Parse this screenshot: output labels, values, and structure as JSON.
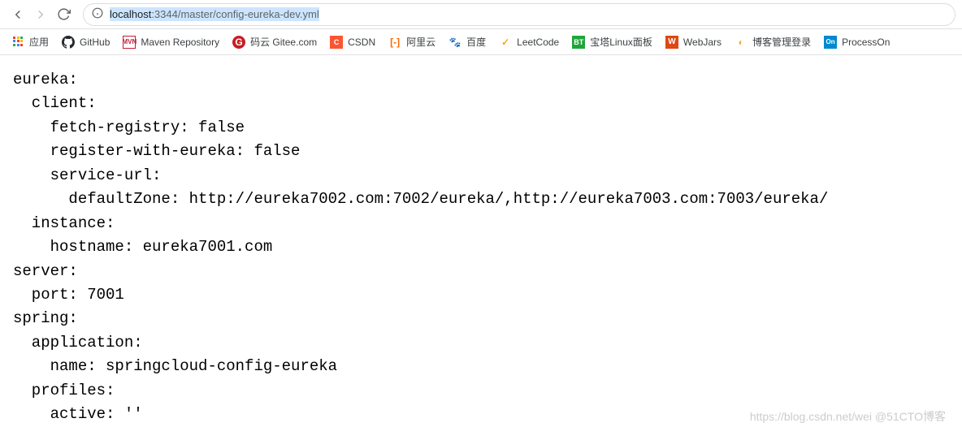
{
  "browser": {
    "url": "localhost:3344/master/config-eureka-dev.yml",
    "url_host": "localhost",
    "url_port_path": ":3344/master/config-eureka-dev.yml"
  },
  "bookmarks": [
    {
      "label": "应用",
      "icon": "apps"
    },
    {
      "label": "GitHub",
      "icon": "github"
    },
    {
      "label": "Maven Repository",
      "icon": "mvn"
    },
    {
      "label": "码云 Gitee.com",
      "icon": "gitee"
    },
    {
      "label": "CSDN",
      "icon": "csdn"
    },
    {
      "label": "阿里云",
      "icon": "aliyun"
    },
    {
      "label": "百度",
      "icon": "baidu"
    },
    {
      "label": "LeetCode",
      "icon": "leetcode"
    },
    {
      "label": "宝塔Linux面板",
      "icon": "bt"
    },
    {
      "label": "WebJars",
      "icon": "webjars"
    },
    {
      "label": "博客管理登录",
      "icon": "blog"
    },
    {
      "label": "ProcessOn",
      "icon": "processon"
    }
  ],
  "yaml_content": "eureka:\n  client:\n    fetch-registry: false\n    register-with-eureka: false\n    service-url:\n      defaultZone: http://eureka7002.com:7002/eureka/,http://eureka7003.com:7003/eureka/\n  instance:\n    hostname: eureka7001.com\nserver:\n  port: 7001\nspring:\n  application:\n    name: springcloud-config-eureka\n  profiles:\n    active: ''",
  "watermark": "https://blog.csdn.net/wei @51CTO博客"
}
